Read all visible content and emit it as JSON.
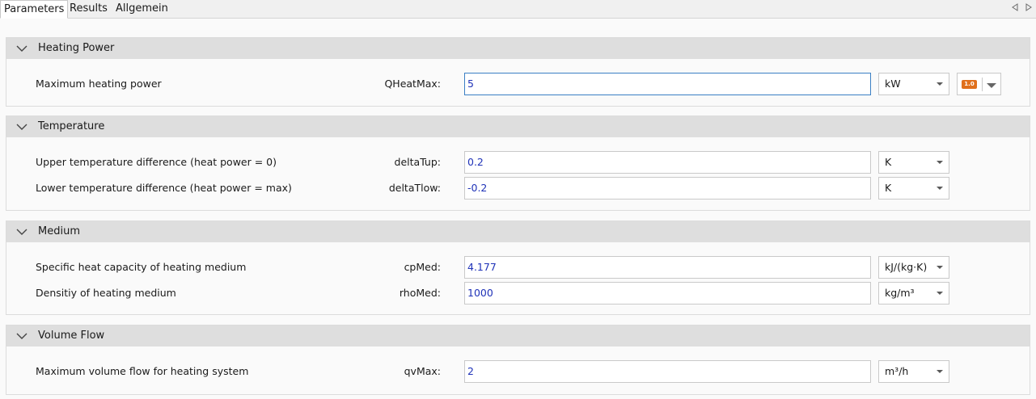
{
  "tabs": [
    {
      "label": "Parameters",
      "active": true
    },
    {
      "label": "Results",
      "active": false
    },
    {
      "label": "Allgemein",
      "active": false
    }
  ],
  "groups": [
    {
      "title": "Heating Power",
      "rows": [
        {
          "description": "Maximum heating power",
          "param": "QHeatMax:",
          "value": "5",
          "unit": "kW",
          "focused": true,
          "badge": "1.0"
        }
      ]
    },
    {
      "title": "Temperature",
      "rows": [
        {
          "description": "Upper temperature difference (heat power = 0)",
          "param": "deltaTup:",
          "value": "0.2",
          "unit": "K"
        },
        {
          "description": "Lower temperature difference (heat power = max)",
          "param": "deltaTlow:",
          "value": "-0.2",
          "unit": "K"
        }
      ]
    },
    {
      "title": "Medium",
      "rows": [
        {
          "description": "Specific heat capacity of heating medium",
          "param": "cpMed:",
          "value": "4.177",
          "unit": "kJ/(kg·K)"
        },
        {
          "description": "Densitiy of heating medium",
          "param": "rhoMed:",
          "value": "1000",
          "unit": "kg/m³"
        }
      ]
    },
    {
      "title": "Volume Flow",
      "rows": [
        {
          "description": "Maximum volume flow for heating system",
          "param": "qvMax:",
          "value": "2",
          "unit": "m³/h"
        }
      ]
    }
  ],
  "icons": {
    "collapse": "chevron-down-icon",
    "unit_dropdown": "dropdown-arrow-icon",
    "tab_scroll_left": "triangle-left-icon",
    "tab_scroll_right": "triangle-right-icon"
  },
  "colors": {
    "value_text": "#2033b8",
    "badge": "#e0701c",
    "group_header": "#dedede"
  }
}
